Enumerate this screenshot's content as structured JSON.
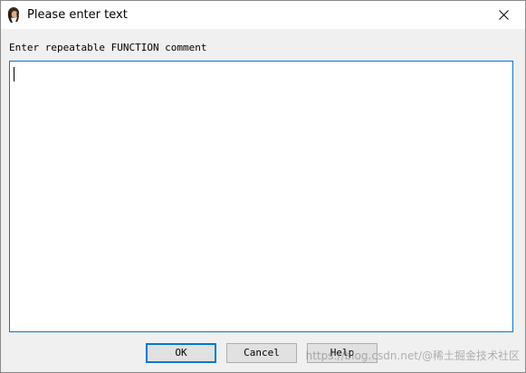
{
  "window": {
    "title": "Please enter text"
  },
  "prompt": {
    "label": "Enter repeatable FUNCTION comment",
    "value": ""
  },
  "buttons": {
    "ok": "OK",
    "cancel": "Cancel",
    "help": "Help"
  },
  "watermark": {
    "text": "https://blog.csdn.net/@稀土掘金技术社区"
  },
  "icons": {
    "app": "ida-app-icon",
    "close": "close-icon"
  },
  "colors": {
    "focus_border": "#0078d7",
    "button_face": "#e1e1e1",
    "dialog_bg": "#f0f0f0"
  }
}
